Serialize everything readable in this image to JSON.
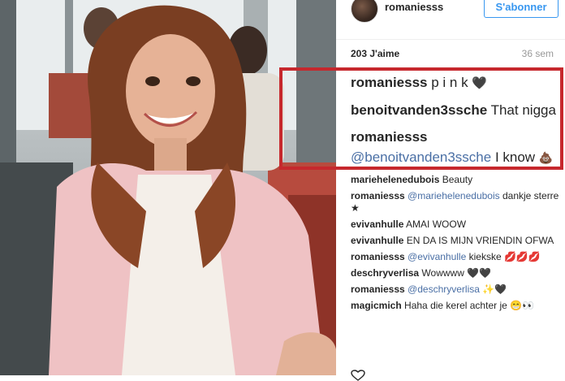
{
  "post": {
    "username": "romaniesss",
    "follow_label": "S'abonner",
    "likes": "203 J'aime",
    "time": "36 sem"
  },
  "featured_comments": [
    {
      "user": "romaniesss",
      "text": "p i n k",
      "emoji": "black-hearts"
    },
    {
      "user": "benoitvanden3ssche",
      "text": "That nigga"
    },
    {
      "user": "romaniesss",
      "mention": "@benoitvanden3ssche",
      "text": "I know",
      "emoji": "poop"
    }
  ],
  "comments": [
    {
      "user": "mariehelenedubois",
      "text": "Beauty"
    },
    {
      "user": "romaniesss",
      "mention": "@mariehelenedubois",
      "text": "dankje sterre",
      "emoji": "star"
    },
    {
      "user": "evivanhulle",
      "text": "AMAI WOOW"
    },
    {
      "user": "evivanhulle",
      "text": "EN DA IS MIJN VRIENDIN OFWA"
    },
    {
      "user": "romaniesss",
      "mention": "@evivanhulle",
      "text": "kiekske",
      "emoji": "kisses"
    },
    {
      "user": "deschryverlisa",
      "text": "Wowwww",
      "emoji": "black-hearts"
    },
    {
      "user": "romaniesss",
      "mention": "@deschryverlisa",
      "text": "",
      "emoji": "sparkle-hearts"
    },
    {
      "user": "magicmich",
      "text": "Haha die kerel achter je",
      "emoji": "grin-eyes"
    }
  ],
  "colors": {
    "highlight": "#c6282d",
    "follow_blue": "#3897f0",
    "mention_blue": "#4a6fa5"
  }
}
